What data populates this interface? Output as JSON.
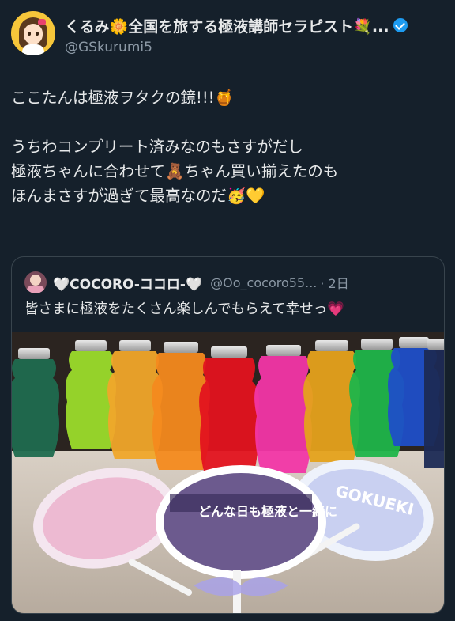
{
  "author": {
    "display_name": "くるみ🌼全国を旅する極液講師セラピスト💐...",
    "handle": "@GSkurumi5",
    "verified": true
  },
  "tweet": {
    "lines": [
      "ここたんは極液ヲタクの鏡!!!🍯",
      "",
      "うちわコンプリート済みなのもさすがだし",
      "極液ちゃんに合わせて🧸ちゃん買い揃えたのも",
      "ほんまさすが過ぎて最高なのだ🥳💛"
    ]
  },
  "quote": {
    "display_name": "🤍COCORO-ココロ-🤍",
    "handle": "@Oo_cocoro55...",
    "time": "· 2日",
    "text": "皆さまに極液をたくさん楽しんでもらえて幸せっ💗",
    "photo_fan_text_right": "GOKUEKI",
    "photo_fan_text_center": "どんな日も極液と一緒に"
  },
  "colors": {
    "background": "#15202b",
    "text": "#e7e9ea",
    "secondary": "#8b98a5",
    "verified": "#1d9bf0",
    "border": "#38444d"
  }
}
